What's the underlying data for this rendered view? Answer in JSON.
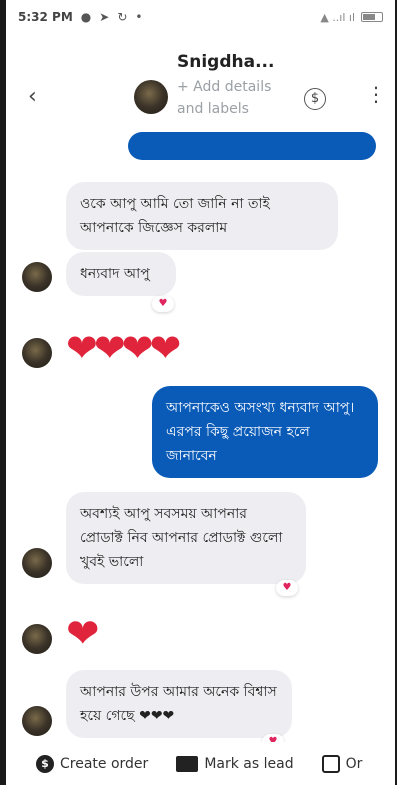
{
  "status_bar": {
    "time": "5:32 PM",
    "icons": [
      "●",
      "➤",
      "↻",
      "•"
    ],
    "right": "▲ ..ıl ıl",
    "battery": "43"
  },
  "header": {
    "contact_name": "Snigdha...",
    "sub_label": "+ Add details and labels",
    "back_glyph": "‹",
    "dollar_glyph": "$",
    "more_glyph": "⋮"
  },
  "messages": [
    {
      "type": "in",
      "text": "ওকে আপু আমি তো জানি না তাই আপনাকে জিজ্ঞেস করলাম"
    },
    {
      "type": "in",
      "text": "ধন্যবাদ আপু",
      "reaction": "♥"
    },
    {
      "type": "in-emoji",
      "text": "❤❤❤❤"
    },
    {
      "type": "out",
      "text": "আপনাকেও অসংখ্য ধন্যবাদ আপু। এরপর কিছু প্রয়োজন হলে জানাবেন"
    },
    {
      "type": "in",
      "text": "অবশ্যই আপু সবসময় আপনার প্রোডাক্ট নিব আপনার প্রোডাক্ট গুলো খুবই ভালো",
      "reaction": "♥"
    },
    {
      "type": "in-emoji",
      "text": "❤"
    },
    {
      "type": "in",
      "text": "আপনার উপর আমার অনেক বিশ্বাস হয়ে গেছে ❤❤❤",
      "reaction": "♥"
    }
  ],
  "bottom_bar": {
    "create_order": "Create order",
    "mark_as_lead": "Mark as lead",
    "third": "Or"
  },
  "colors": {
    "outgoing": "#0a5bb8",
    "incoming": "#eeeef2",
    "heart": "#e0243b"
  }
}
